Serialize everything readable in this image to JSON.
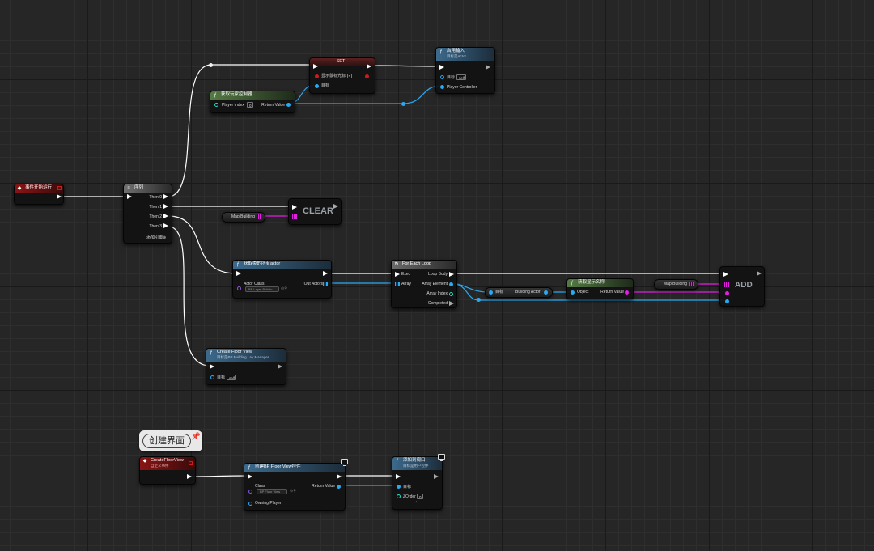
{
  "comment": {
    "text": "创建界面",
    "icon": "pin-icon"
  },
  "nodes": {
    "begin_play": {
      "title": "事件开始运行"
    },
    "sequence": {
      "title": "序列",
      "pins": [
        "Then 0",
        "Then 1",
        "Then 2",
        "Then 3"
      ],
      "add_pin": "添加引脚"
    },
    "set_node": {
      "title": "SET",
      "pin_show_cursor": "显示鼠标光标",
      "pin_target": "目标"
    },
    "get_player_controller": {
      "title": "获取玩家控制器",
      "pin_player_index": "Player Index",
      "player_index_value": "0",
      "pin_return": "Return Value"
    },
    "enable_input": {
      "title": "启用输入",
      "subtitle": "目标是Actor",
      "pin_target": "目标",
      "target_value": "self",
      "pin_player_controller": "Player Controller"
    },
    "clear": {
      "macro": "CLEAR"
    },
    "map_building_1": {
      "label": "Map Building"
    },
    "get_all_actors": {
      "title": "获取类的所有actor",
      "pin_actor_class": "Actor Class",
      "class_value": "BP Layer Buildin",
      "pin_out_actors": "Out Actors"
    },
    "for_each_loop": {
      "title": "For Each Loop",
      "pin_exec": "Exec",
      "pin_array": "Array",
      "pin_loop_body": "Loop Body",
      "pin_array_element": "Array Element",
      "pin_array_index": "Array Index",
      "pin_completed": "Completed"
    },
    "building_actor": {
      "pin_target": "目标",
      "pin_value": "Building Actor"
    },
    "get_display_name": {
      "title": "获取显示名称",
      "pin_object": "Object",
      "pin_return": "Return Value"
    },
    "map_building_2": {
      "label": "Map Building"
    },
    "add": {
      "macro": "ADD"
    },
    "create_floor_view_call": {
      "title": "Create Floor View",
      "subtitle": "目标是BP Building Lay Manager",
      "pin_target": "目标",
      "target_value": "self"
    },
    "custom_event": {
      "title": "CreateFloorView",
      "subtitle": "自定义事件"
    },
    "create_widget": {
      "title": "创建BP Floor View控件",
      "pin_class": "Class",
      "class_value": "BP Floor View",
      "pin_return": "Return Value",
      "pin_owning_player": "Owning Player"
    },
    "add_to_viewport": {
      "title": "添加到视口",
      "subtitle": "目标是用户控件",
      "pin_target": "目标",
      "pin_zorder": "ZOrder",
      "zorder_value": "0"
    }
  },
  "colors": {
    "exec": "#ffffff",
    "object": "#2aa9f0",
    "string": "#e31ee3",
    "event_header": "#8a1515",
    "function_header": "#3c6a8c",
    "pure_header": "#557a44"
  }
}
